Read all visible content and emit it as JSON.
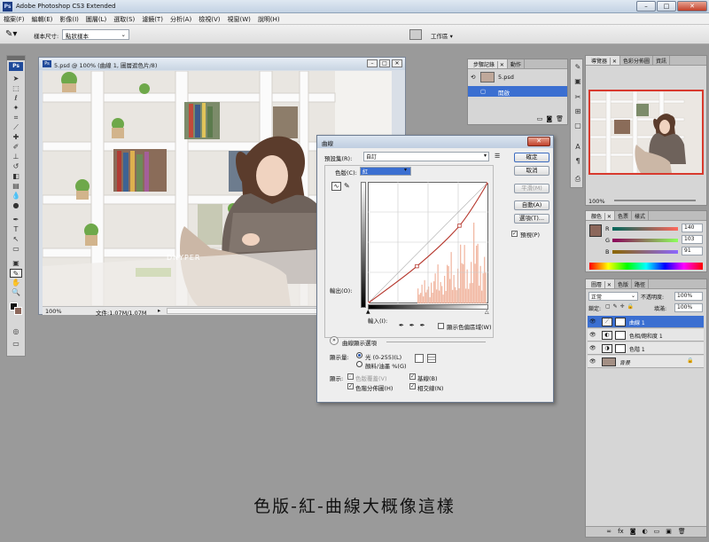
{
  "app": {
    "title": "Adobe Photoshop CS3 Extended"
  },
  "menu": [
    "檔案(F)",
    "編輯(E)",
    "影像(I)",
    "圖層(L)",
    "選取(S)",
    "濾鏡(T)",
    "分析(A)",
    "檢視(V)",
    "視窗(W)",
    "說明(H)"
  ],
  "options_bar": {
    "sample_size_label": "樣本尺寸:",
    "sample_size_value": "點狀樣本",
    "workspace": "工作區"
  },
  "document": {
    "title": "5.psd @ 100% (曲線 1, 圖層遮色片/8)",
    "zoom": "100%",
    "file_info": "文件:1.07M/1.07M",
    "watermark": "DNYPER"
  },
  "curves": {
    "title": "曲線",
    "preset_label": "預設集(R):",
    "preset_value": "自訂",
    "channel_label": "色版(C):",
    "channel_value": "紅",
    "output_label": "輸出(O):",
    "input_label": "輸入(I):",
    "show_clipping": "顯示色偏區域(W)",
    "buttons": {
      "ok": "確定",
      "cancel": "取消",
      "smooth": "平滑(M)",
      "auto": "自動(A)",
      "options": "選項(T)..."
    },
    "preview_label": "預視(P)",
    "display_options_title": "曲線顯示選項",
    "show_amount_label": "顯示量:",
    "light_option": "光 (0-255)(L)",
    "pigment_option": "顏料/油墨 %(G)",
    "show_label": "顯示:",
    "channel_overlays": "色版覆蓋(V)",
    "baseline": "基線(B)",
    "histogram": "色階分佈圖(H)",
    "intersection": "相交線(N)",
    "curve_points": [
      [
        0,
        0
      ],
      [
        104,
        78
      ],
      [
        194,
        163
      ],
      [
        255,
        255
      ]
    ]
  },
  "history_panel": {
    "tabs": [
      "步驟記錄",
      "動作"
    ],
    "document": "5.psd",
    "items": [
      "開啟"
    ]
  },
  "navigator_panel": {
    "tabs": [
      "導覽器",
      "色彩分佈圖",
      "資訊"
    ],
    "zoom": "100%"
  },
  "color_panel": {
    "tabs": [
      "顏色",
      "色票",
      "樣式"
    ],
    "r": "140",
    "g": "103",
    "b": "91",
    "swatch": "#8c675b",
    "r_label": "R",
    "g_label": "G",
    "b_label": "B"
  },
  "layers_panel": {
    "tabs": [
      "圖層",
      "色版",
      "路徑"
    ],
    "blend_mode": "正常",
    "opacity_label": "不透明度:",
    "opacity": "100%",
    "lock_label": "鎖定:",
    "fill_label": "填滿:",
    "fill": "100%",
    "layers": [
      {
        "name": "曲線 1",
        "selected": true
      },
      {
        "name": "色相/飽和度 1",
        "selected": false
      },
      {
        "name": "色階 1",
        "selected": false
      },
      {
        "name": "背景",
        "selected": false
      }
    ]
  },
  "caption": "色版-紅-曲線大概像這樣",
  "colors": {
    "accent": "#3b6fd1",
    "curve": "#b5352b",
    "histogram": "#f2b9a4"
  }
}
